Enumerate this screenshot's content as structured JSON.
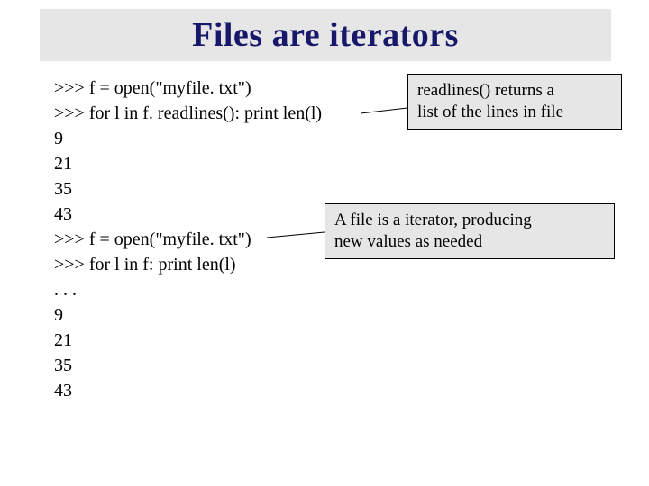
{
  "title": "Files are iterators",
  "code": {
    "l1": ">>> f = open(\"myfile. txt\")",
    "l2": ">>> for l in f. readlines(): print len(l)",
    "l3": "9",
    "l4": "21",
    "l5": "35",
    "l6": "43",
    "l7": ">>> f = open(\"myfile. txt\")",
    "l8": ">>> for l in f: print len(l)",
    "l9": ". . .",
    "l10": "9",
    "l11": "21",
    "l12": "35",
    "l13": "43"
  },
  "callouts": {
    "c1_line1": "readlines() returns a",
    "c1_line2": "list of the lines in file",
    "c2_line1": "A file is a iterator, producing",
    "c2_line2": "new values as needed"
  }
}
